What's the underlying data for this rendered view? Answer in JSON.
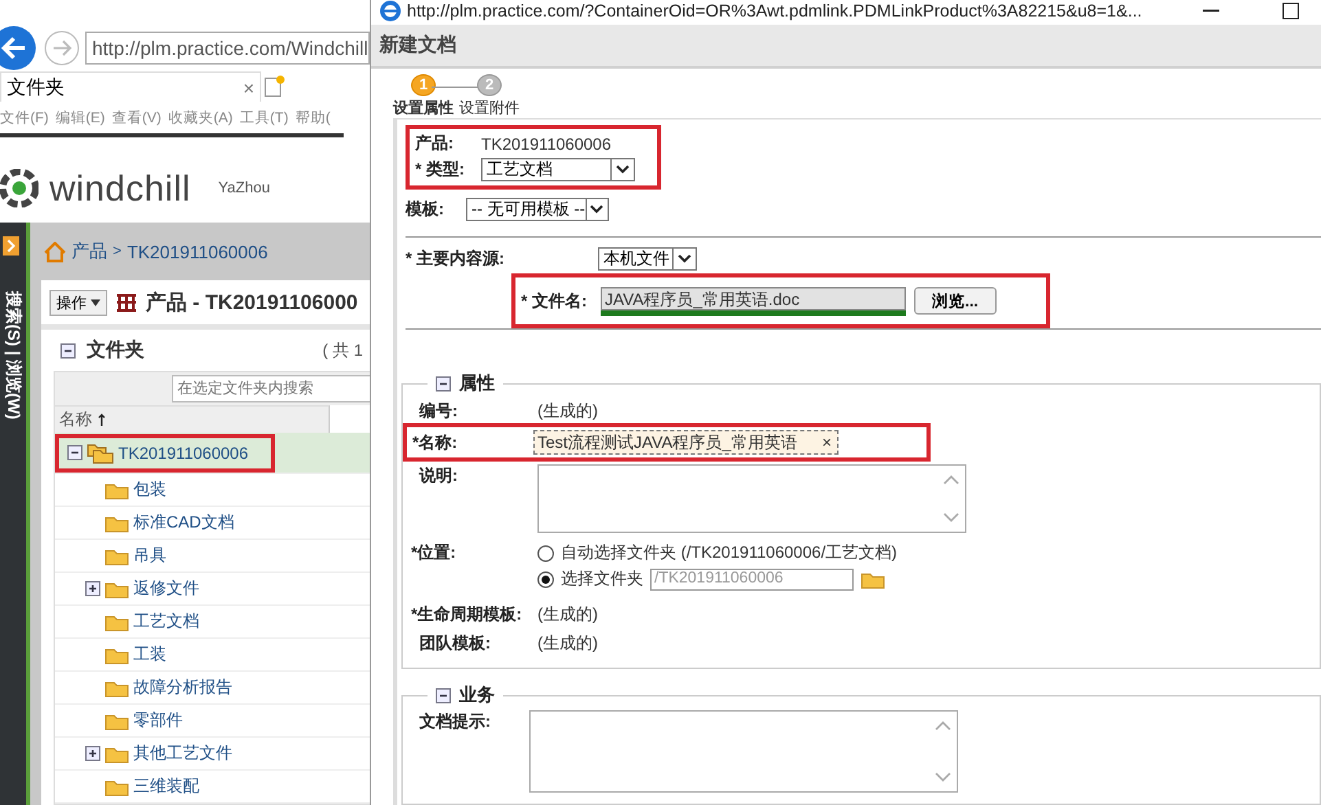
{
  "back_window": {
    "address": "http://plm.practice.com/Windchill",
    "tab": {
      "label": "文件夹",
      "close": "×"
    },
    "menu": [
      "文件(F)",
      "编辑(E)",
      "查看(V)",
      "收藏夹(A)",
      "工具(T)",
      "帮助("
    ],
    "brand": {
      "logo": "windchill",
      "user": "YaZhou"
    },
    "side_nav": "搜索(S) | 浏览(W)",
    "breadcrumb": [
      "产品",
      ">",
      "TK201911060006"
    ],
    "actions_button": "操作",
    "page_title": "产品 - TK20191106000",
    "folders": {
      "title": "文件夹",
      "count": "( 共 1",
      "search_placeholder": "在选定文件夹内搜索",
      "column": "名称",
      "tree": [
        {
          "label": "TK201911060006",
          "expanded": true,
          "selected": true,
          "highlighted": true,
          "children": [
            {
              "label": "包装",
              "kind": "leaf"
            },
            {
              "label": "标准CAD文档",
              "kind": "leaf"
            },
            {
              "label": "吊具",
              "kind": "leaf"
            },
            {
              "label": "返修文件",
              "kind": "branch",
              "expanded": false
            },
            {
              "label": "工艺文档",
              "kind": "leaf"
            },
            {
              "label": "工装",
              "kind": "leaf"
            },
            {
              "label": "故障分析报告",
              "kind": "leaf"
            },
            {
              "label": "零部件",
              "kind": "leaf"
            },
            {
              "label": "其他工艺文件",
              "kind": "branch",
              "expanded": false
            },
            {
              "label": "三维装配",
              "kind": "leaf"
            }
          ]
        }
      ]
    }
  },
  "dialog": {
    "url": "http://plm.practice.com/?ContainerOid=OR%3Awt.pdmlink.PDMLinkProduct%3A82215&u8=1&...",
    "title": "新建文档",
    "steps": [
      {
        "number": "1",
        "label": "设置属性",
        "selected": true
      },
      {
        "number": "2",
        "label": "设置附件",
        "selected": false
      }
    ],
    "product": {
      "label": "产品:",
      "value": "TK201911060006",
      "highlighted": true
    },
    "type": {
      "label": "* 类型:",
      "value": "工艺文档"
    },
    "template": {
      "label": "模板:",
      "value": "-- 无可用模板 --"
    },
    "content_source": {
      "label": "* 主要内容源:",
      "value": "本机文件"
    },
    "file_name": {
      "label": "* 文件名:",
      "value": "JAVA程序员_常用英语.doc",
      "level": 1,
      "button": "浏览...",
      "highlighted": true
    },
    "attributes": {
      "title": "属性",
      "expanded": true,
      "number": {
        "label": "编号:",
        "value": "(生成的)"
      },
      "name": {
        "label": "*名称:",
        "value": "Test流程测试JAVA程序员_常用英语",
        "clear": "×",
        "highlighted": true
      },
      "description": {
        "label": "说明:"
      },
      "location": {
        "label": "*位置:",
        "options": [
          {
            "label": "自动选择文件夹 (/TK201911060006/工艺文档)",
            "selected": false
          },
          {
            "label": "选择文件夹",
            "selected": true,
            "value": "/TK201911060006",
            "disabled": true
          }
        ]
      },
      "lifecycle": {
        "label": "*生命周期模板:",
        "value": "(生成的)"
      },
      "team": {
        "label": "团队模板:",
        "value": "(生成的)"
      }
    },
    "business": {
      "title": "业务",
      "expanded": true,
      "hint": {
        "label": "文档提示:"
      }
    }
  }
}
